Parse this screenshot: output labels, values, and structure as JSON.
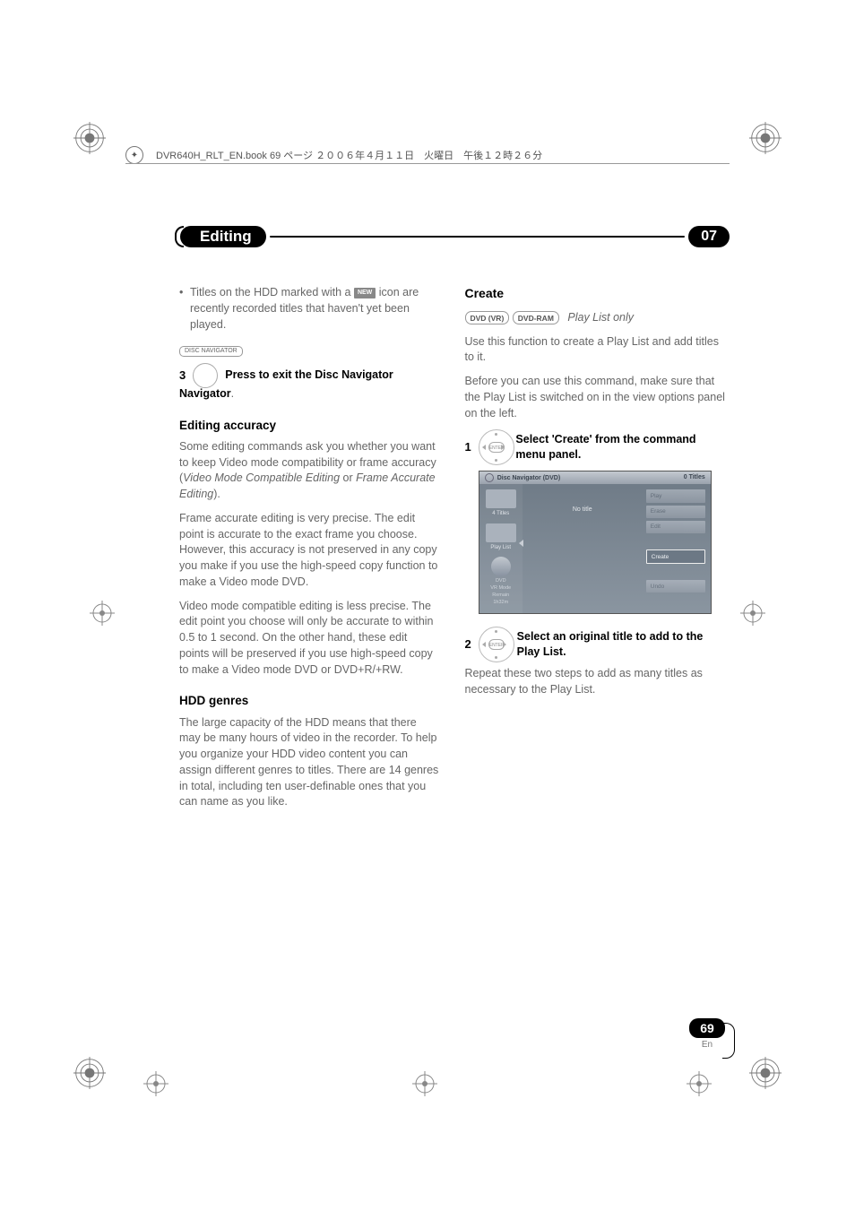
{
  "header": {
    "text": "DVR640H_RLT_EN.book  69 ページ  ２００６年４月１１日　火曜日　午後１２時２６分"
  },
  "chapter": {
    "title": "Editing",
    "number": "07"
  },
  "left": {
    "bullet": {
      "pre": "Titles on the HDD marked with a ",
      "badge": "NEW",
      "post": " icon are recently recorded titles that haven't yet been played."
    },
    "step3": {
      "num": "3",
      "badge": "DISC NAVIGATOR",
      "text": "Press to exit the Disc Navigator"
    },
    "accuracy": {
      "h": "Editing accuracy",
      "p1a": "Some editing commands ask you whether you want to keep Video mode compatibility or frame accuracy (",
      "p1b": "Video Mode Compatible Editing",
      "p1c": " or ",
      "p1d": "Frame Accurate Editing",
      "p1e": ").",
      "p2": "Frame accurate editing is very precise. The edit point is accurate to the exact frame you choose. However, this accuracy is not preserved in any copy you make if you use the high-speed copy function to make a Video mode DVD.",
      "p3": "Video mode compatible editing is less precise. The edit point you choose will only be accurate to within 0.5 to 1 second. On the other hand, these edit points will be preserved if you use high-speed copy to make a Video mode DVD or DVD+R/+RW."
    },
    "hdd": {
      "h": "HDD genres",
      "p": "The large capacity of the HDD means that there may be many hours of video in the recorder. To help you organize your HDD video content you can assign different genres to titles. There are 14 genres in total, including ten user-definable ones that you can name as you like."
    }
  },
  "right": {
    "create": "Create",
    "labels": {
      "vr": "DVD (VR)",
      "ram": "DVD-RAM",
      "note": "Play List only"
    },
    "p1": "Use this function to create a Play List and add titles to it.",
    "p2": "Before you can use this command, make sure that the Play List is switched on in the view options panel on the left.",
    "step1": {
      "num": "1",
      "enter": "ENTER",
      "text": "Select 'Create' from the command menu panel."
    },
    "step2": {
      "num": "2",
      "enter": "ENTER",
      "text": "Select an original title to add to the Play List."
    },
    "p3": "Repeat these two steps to add as many titles as necessary to the Play List."
  },
  "ui": {
    "title": "Disc Navigator (DVD)",
    "count": "0 Titles",
    "tiles": {
      "t1": "4 Titles",
      "t2": "Play List"
    },
    "center": "No title",
    "menu": {
      "play": "Play",
      "erase": "Erase",
      "edit": "Edit",
      "create": "Create",
      "undo": "Undo"
    },
    "mode": {
      "l1": "DVD",
      "l2": "VR Mode",
      "l3": "Remain",
      "l4": "1h32m"
    }
  },
  "page": {
    "num": "69",
    "lang": "En"
  }
}
